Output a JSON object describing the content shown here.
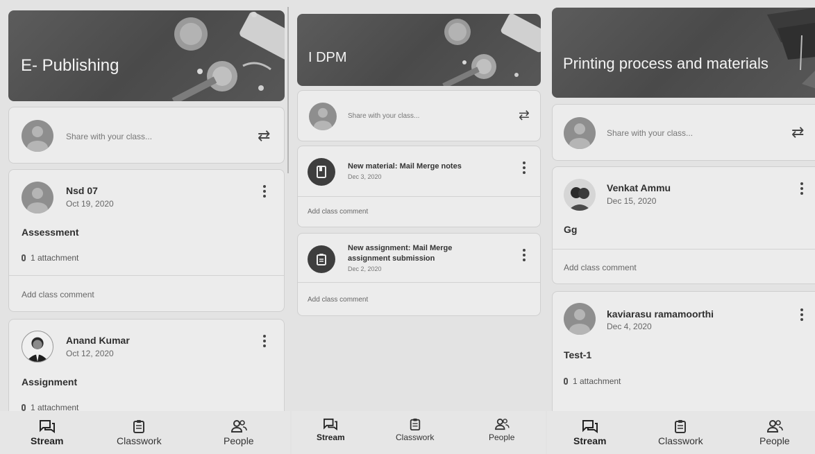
{
  "screens": [
    {
      "class_name": "E- Publishing",
      "share_placeholder": "Share with your class...",
      "posts": [
        {
          "author": "Nsd 07",
          "date": "Oct 19, 2020",
          "text": "Assessment",
          "attachment": "1 attachment",
          "comment_placeholder": "Add class comment"
        },
        {
          "author": "Anand Kumar",
          "date": "Oct 12, 2020",
          "text": "Assignment",
          "attachment": "1 attachment"
        }
      ]
    },
    {
      "class_name": "I DPM",
      "share_placeholder": "Share with your class...",
      "items": [
        {
          "icon": "material-icon",
          "title": "New material: Mail Merge notes",
          "date": "Dec 3, 2020",
          "comment_placeholder": "Add class comment"
        },
        {
          "icon": "assignment-icon",
          "title": "New assignment: Mail Merge assignment submission",
          "date": "Dec 2, 2020",
          "comment_placeholder": "Add class comment"
        }
      ]
    },
    {
      "class_name": "Printing process and materials",
      "share_placeholder": "Share with your class...",
      "posts": [
        {
          "author": "Venkat Ammu",
          "date": "Dec 15, 2020",
          "text": "Gg",
          "comment_placeholder": "Add class comment"
        },
        {
          "author": "kaviarasu ramamoorthi",
          "date": "Dec 4, 2020",
          "text": "Test-1",
          "attachment": "1 attachment"
        }
      ]
    }
  ],
  "nav": {
    "stream": "Stream",
    "classwork": "Classwork",
    "people": "People"
  },
  "icons": {
    "repost": "repost-icon",
    "more": "more-vert-icon",
    "attachment": "paperclip-icon",
    "stream": "stream-icon",
    "classwork": "classwork-icon",
    "people": "people-icon"
  }
}
